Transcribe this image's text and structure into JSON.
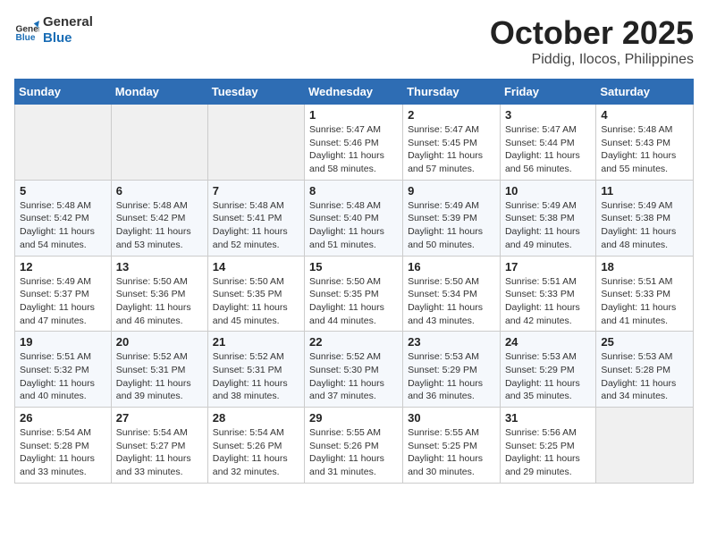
{
  "header": {
    "logo_line1": "General",
    "logo_line2": "Blue",
    "month_title": "October 2025",
    "location": "Piddig, Ilocos, Philippines"
  },
  "weekdays": [
    "Sunday",
    "Monday",
    "Tuesday",
    "Wednesday",
    "Thursday",
    "Friday",
    "Saturday"
  ],
  "weeks": [
    [
      {
        "day": "",
        "info": ""
      },
      {
        "day": "",
        "info": ""
      },
      {
        "day": "",
        "info": ""
      },
      {
        "day": "1",
        "info": "Sunrise: 5:47 AM\nSunset: 5:46 PM\nDaylight: 11 hours\nand 58 minutes."
      },
      {
        "day": "2",
        "info": "Sunrise: 5:47 AM\nSunset: 5:45 PM\nDaylight: 11 hours\nand 57 minutes."
      },
      {
        "day": "3",
        "info": "Sunrise: 5:47 AM\nSunset: 5:44 PM\nDaylight: 11 hours\nand 56 minutes."
      },
      {
        "day": "4",
        "info": "Sunrise: 5:48 AM\nSunset: 5:43 PM\nDaylight: 11 hours\nand 55 minutes."
      }
    ],
    [
      {
        "day": "5",
        "info": "Sunrise: 5:48 AM\nSunset: 5:42 PM\nDaylight: 11 hours\nand 54 minutes."
      },
      {
        "day": "6",
        "info": "Sunrise: 5:48 AM\nSunset: 5:42 PM\nDaylight: 11 hours\nand 53 minutes."
      },
      {
        "day": "7",
        "info": "Sunrise: 5:48 AM\nSunset: 5:41 PM\nDaylight: 11 hours\nand 52 minutes."
      },
      {
        "day": "8",
        "info": "Sunrise: 5:48 AM\nSunset: 5:40 PM\nDaylight: 11 hours\nand 51 minutes."
      },
      {
        "day": "9",
        "info": "Sunrise: 5:49 AM\nSunset: 5:39 PM\nDaylight: 11 hours\nand 50 minutes."
      },
      {
        "day": "10",
        "info": "Sunrise: 5:49 AM\nSunset: 5:38 PM\nDaylight: 11 hours\nand 49 minutes."
      },
      {
        "day": "11",
        "info": "Sunrise: 5:49 AM\nSunset: 5:38 PM\nDaylight: 11 hours\nand 48 minutes."
      }
    ],
    [
      {
        "day": "12",
        "info": "Sunrise: 5:49 AM\nSunset: 5:37 PM\nDaylight: 11 hours\nand 47 minutes."
      },
      {
        "day": "13",
        "info": "Sunrise: 5:50 AM\nSunset: 5:36 PM\nDaylight: 11 hours\nand 46 minutes."
      },
      {
        "day": "14",
        "info": "Sunrise: 5:50 AM\nSunset: 5:35 PM\nDaylight: 11 hours\nand 45 minutes."
      },
      {
        "day": "15",
        "info": "Sunrise: 5:50 AM\nSunset: 5:35 PM\nDaylight: 11 hours\nand 44 minutes."
      },
      {
        "day": "16",
        "info": "Sunrise: 5:50 AM\nSunset: 5:34 PM\nDaylight: 11 hours\nand 43 minutes."
      },
      {
        "day": "17",
        "info": "Sunrise: 5:51 AM\nSunset: 5:33 PM\nDaylight: 11 hours\nand 42 minutes."
      },
      {
        "day": "18",
        "info": "Sunrise: 5:51 AM\nSunset: 5:33 PM\nDaylight: 11 hours\nand 41 minutes."
      }
    ],
    [
      {
        "day": "19",
        "info": "Sunrise: 5:51 AM\nSunset: 5:32 PM\nDaylight: 11 hours\nand 40 minutes."
      },
      {
        "day": "20",
        "info": "Sunrise: 5:52 AM\nSunset: 5:31 PM\nDaylight: 11 hours\nand 39 minutes."
      },
      {
        "day": "21",
        "info": "Sunrise: 5:52 AM\nSunset: 5:31 PM\nDaylight: 11 hours\nand 38 minutes."
      },
      {
        "day": "22",
        "info": "Sunrise: 5:52 AM\nSunset: 5:30 PM\nDaylight: 11 hours\nand 37 minutes."
      },
      {
        "day": "23",
        "info": "Sunrise: 5:53 AM\nSunset: 5:29 PM\nDaylight: 11 hours\nand 36 minutes."
      },
      {
        "day": "24",
        "info": "Sunrise: 5:53 AM\nSunset: 5:29 PM\nDaylight: 11 hours\nand 35 minutes."
      },
      {
        "day": "25",
        "info": "Sunrise: 5:53 AM\nSunset: 5:28 PM\nDaylight: 11 hours\nand 34 minutes."
      }
    ],
    [
      {
        "day": "26",
        "info": "Sunrise: 5:54 AM\nSunset: 5:28 PM\nDaylight: 11 hours\nand 33 minutes."
      },
      {
        "day": "27",
        "info": "Sunrise: 5:54 AM\nSunset: 5:27 PM\nDaylight: 11 hours\nand 33 minutes."
      },
      {
        "day": "28",
        "info": "Sunrise: 5:54 AM\nSunset: 5:26 PM\nDaylight: 11 hours\nand 32 minutes."
      },
      {
        "day": "29",
        "info": "Sunrise: 5:55 AM\nSunset: 5:26 PM\nDaylight: 11 hours\nand 31 minutes."
      },
      {
        "day": "30",
        "info": "Sunrise: 5:55 AM\nSunset: 5:25 PM\nDaylight: 11 hours\nand 30 minutes."
      },
      {
        "day": "31",
        "info": "Sunrise: 5:56 AM\nSunset: 5:25 PM\nDaylight: 11 hours\nand 29 minutes."
      },
      {
        "day": "",
        "info": ""
      }
    ]
  ]
}
